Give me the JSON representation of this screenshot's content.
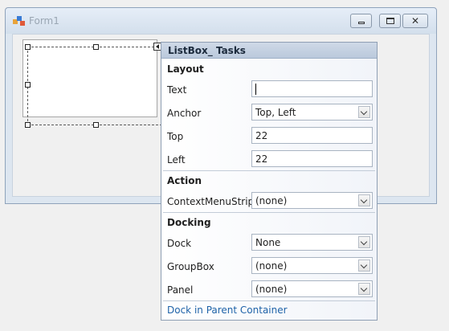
{
  "window": {
    "title": "Form1"
  },
  "panel": {
    "title": "ListBox_ Tasks",
    "sections": {
      "layout": "Layout",
      "action": "Action",
      "docking": "Docking"
    },
    "fields": {
      "text": {
        "label": "Text",
        "value": ""
      },
      "anchor": {
        "label": "Anchor",
        "value": "Top, Left"
      },
      "top": {
        "label": "Top",
        "value": "22"
      },
      "left": {
        "label": "Left",
        "value": "22"
      },
      "context_menu_strip": {
        "label": "ContextMenuStrip",
        "value": "(none)"
      },
      "dock": {
        "label": "Dock",
        "value": "None"
      },
      "group_box": {
        "label": "GroupBox",
        "value": "(none)"
      },
      "panel": {
        "label": "Panel",
        "value": "(none)"
      }
    },
    "link": "Dock in Parent Container"
  },
  "icons": {
    "app": "app-form-icon",
    "minimize": "minimize-icon",
    "maximize": "maximize-icon",
    "close": "close-icon",
    "smart_tag": "smart-tag-arrow-icon",
    "dropdown": "chevron-down-icon"
  },
  "colors": {
    "title_text": "#9aa6b3",
    "panel_header": "#c4d0e0",
    "link": "#1e62a8"
  }
}
